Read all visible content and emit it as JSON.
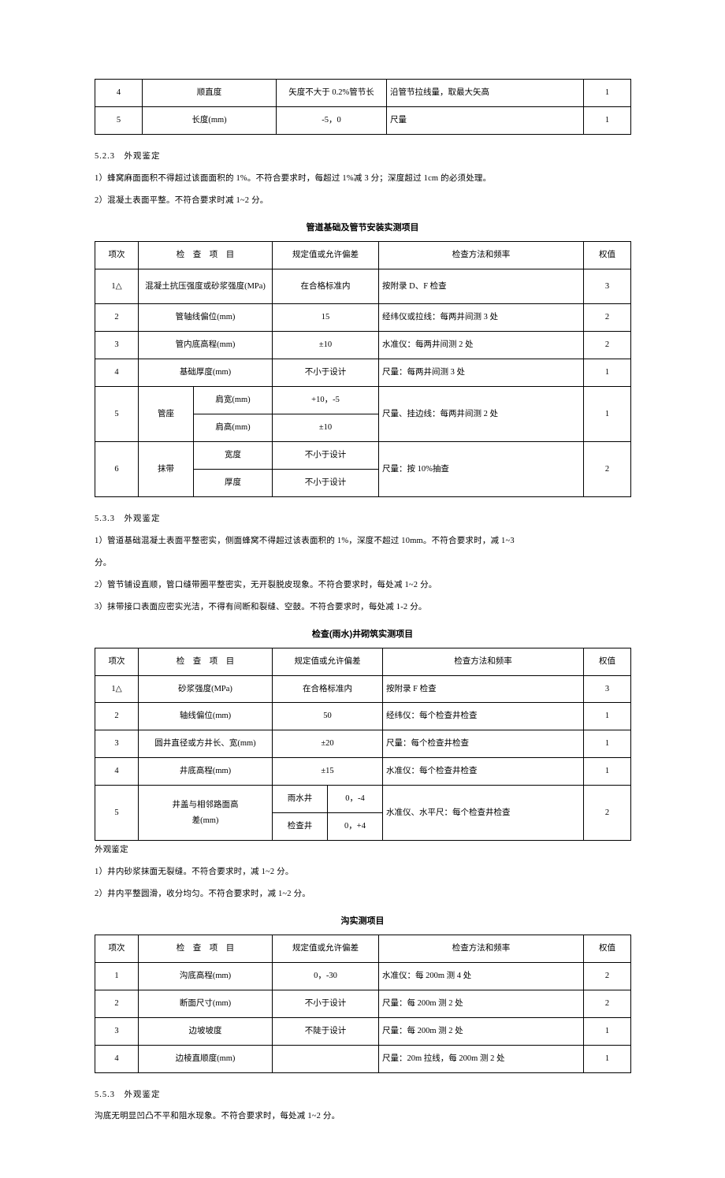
{
  "table1": {
    "rows": [
      [
        "4",
        "顺直度",
        "矢度不大于 0.2%管节长",
        "沿管节拉线量，取最大矢高",
        "1"
      ],
      [
        "5",
        "长度(mm)",
        "-5，0",
        "尺量",
        "1"
      ]
    ]
  },
  "sec523": {
    "heading": "5.2.3　外观鉴定",
    "p1": "1）蜂窝麻面面积不得超过该面面积的 1%。不符合要求时，每超过 1%减 3 分；深度超过 1cm 的必须处理。",
    "p2": "2）混凝土表面平整。不符合要求时减 1~2 分。"
  },
  "table2": {
    "caption": "管道基础及管节安装实测项目",
    "header": [
      "项次",
      "检　查　项　目",
      "规定值或允许偏差",
      "检查方法和频率",
      "权值"
    ],
    "r1": [
      "1△",
      "混凝土抗压强度或砂浆强度(MPa)",
      "在合格标准内",
      "按附录 D、F 检查",
      "3"
    ],
    "r2": [
      "2",
      "管轴线偏位(mm)",
      "15",
      "经纬仪或拉线：每两井间测 3 处",
      "2"
    ],
    "r3": [
      "3",
      "管内底高程(mm)",
      "±10",
      "水准仪：每两井间测 2 处",
      "2"
    ],
    "r4": [
      "4",
      "基础厚度(mm)",
      "不小于设计",
      "尺量：每两井间测 3 处",
      "1"
    ],
    "r5": {
      "n": "5",
      "label": "管座",
      "sub": [
        [
          "肩宽(mm)",
          "+10，-5"
        ],
        [
          "肩高(mm)",
          "±10"
        ]
      ],
      "method": "尺量、挂边线：每两井间测 2 处",
      "w": "1"
    },
    "r6": {
      "n": "6",
      "label": "抹带",
      "sub": [
        [
          "宽度",
          "不小于设计"
        ],
        [
          "厚度",
          "不小于设计"
        ]
      ],
      "method": "尺量：按 10%抽查",
      "w": "2"
    }
  },
  "sec533": {
    "heading": "5.3.3　外观鉴定",
    "p1": "1）管道基础混凝土表面平整密实，侧面蜂窝不得超过该表面积的 1%，深度不超过 10mm。不符合要求时，减 1~3",
    "p1b": "分。",
    "p2": "2）管节铺设直顺，管口缝带圈平整密实，无开裂脱皮现象。不符合要求时，每处减 1~2 分。",
    "p3": "3）抹带接口表面应密实光洁，不得有间断和裂缝、空鼓。不符合要求时，每处减 1-2 分。"
  },
  "table3": {
    "caption": "检查(雨水)井砌筑实测项目",
    "header": [
      "项次",
      "检　查　项　目",
      "规定值或允许偏差",
      "检查方法和频率",
      "权值"
    ],
    "r1": [
      "1△",
      "砂浆强度(MPa)",
      "在合格标准内",
      "按附录 F 检查",
      "3"
    ],
    "r2": [
      "2",
      "轴线偏位(mm)",
      "50",
      "经纬仪：每个检查井检查",
      "1"
    ],
    "r3": [
      "3",
      "圆井直径或方井长、宽(mm)",
      "±20",
      "尺量：每个检查井检查",
      "1"
    ],
    "r4": [
      "4",
      "井底高程(mm)",
      "±15",
      "水准仪：每个检查井检查",
      "1"
    ],
    "r5": {
      "n": "5",
      "label_top": "井盖与相邻路面高",
      "label_bot": "差(mm)",
      "sub": [
        [
          "雨水井",
          "0，-4"
        ],
        [
          "检查井",
          "0，+4"
        ]
      ],
      "method": "水准仪、水平尺：每个检查井检查",
      "w": "2"
    }
  },
  "sec_wg": {
    "heading": "外观鉴定",
    "p1": "1）井内砂浆抹面无裂缝。不符合要求时，减 1~2 分。",
    "p2": "2）井内平整圆滑，收分均匀。不符合要求时，减 1~2 分。"
  },
  "table4": {
    "caption": "沟实测项目",
    "header": [
      "项次",
      "检　查　项　目",
      "规定值或允许偏差",
      "检查方法和频率",
      "权值"
    ],
    "rows": [
      [
        "1",
        "沟底高程(mm)",
        "0，-30",
        "水准仪：每 200m 测 4 处",
        "2"
      ],
      [
        "2",
        "断面尺寸(mm)",
        "不小于设计",
        "尺量：每 200m 测 2 处",
        "2"
      ],
      [
        "3",
        "边坡坡度",
        "不陡于设计",
        "尺量：每 200m 测 2 处",
        "1"
      ],
      [
        "4",
        "边棱直顺度(mm)",
        "",
        "尺量：20m 拉线，每 200m 测 2 处",
        "1"
      ]
    ]
  },
  "sec553": {
    "heading": "5.5.3　外观鉴定",
    "p1": "沟底无明显凹凸不平和阻水现象。不符合要求时，每处减 1~2 分。"
  }
}
